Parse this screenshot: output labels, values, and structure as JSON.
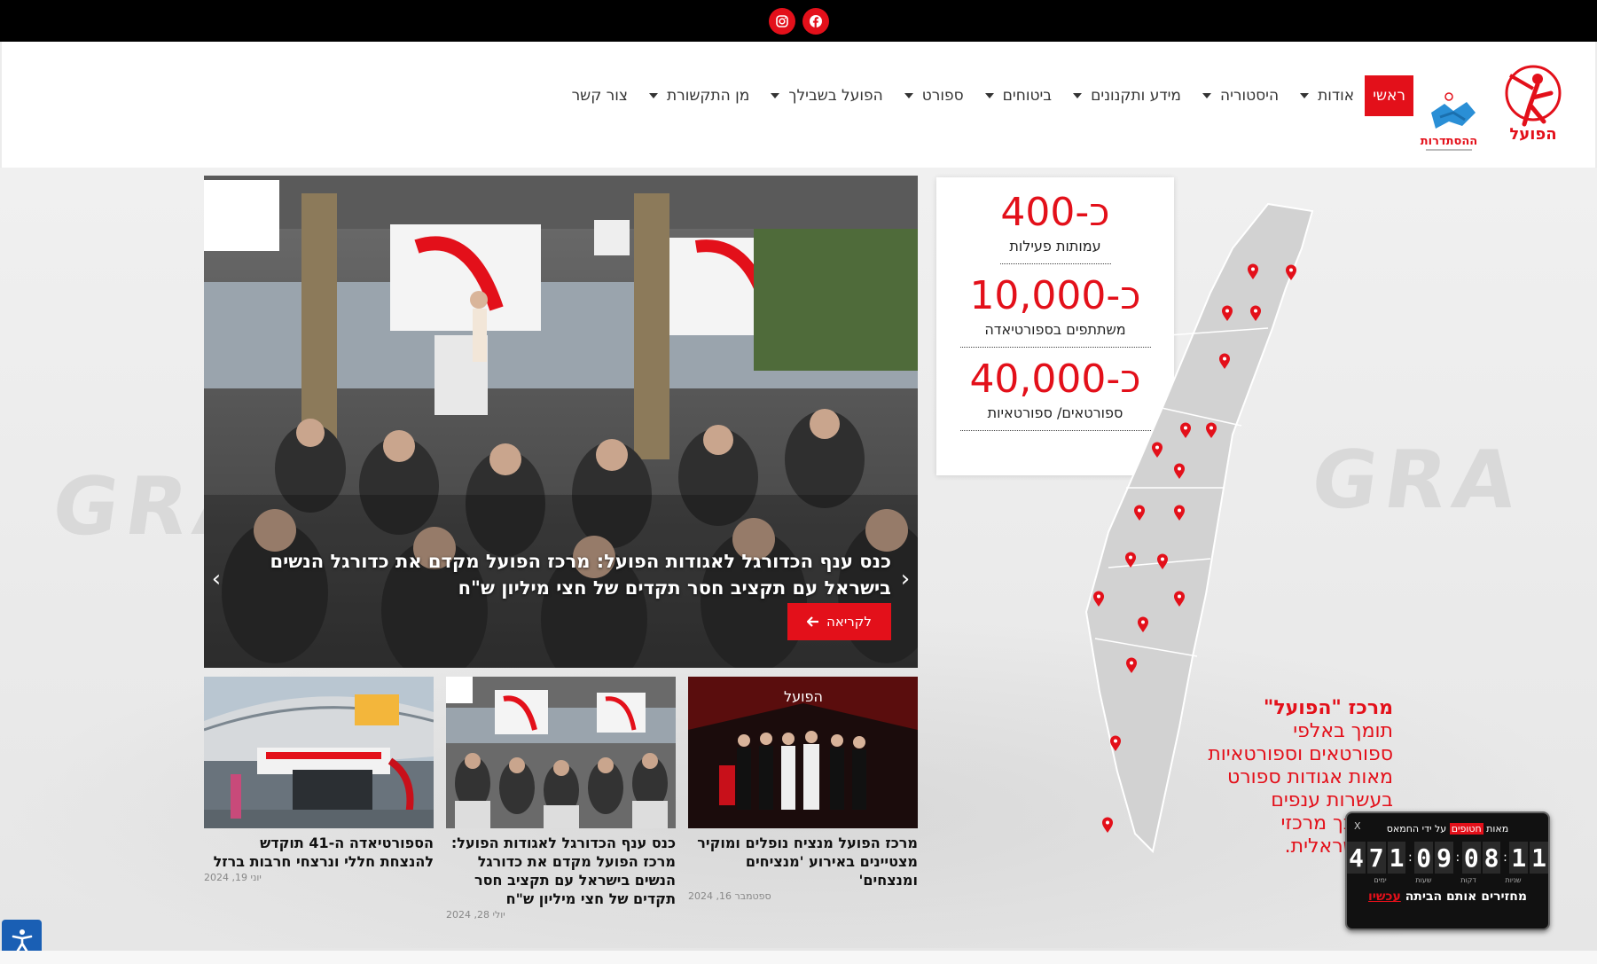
{
  "topbar": {
    "social": [
      {
        "name": "instagram-icon"
      },
      {
        "name": "facebook-icon"
      }
    ]
  },
  "logos": {
    "hapoel_text": "הפועל",
    "histadrut_text": "ההסתדרות"
  },
  "nav": {
    "items": [
      {
        "label": "ראשי",
        "active": true,
        "dropdown": false
      },
      {
        "label": "אודות",
        "dropdown": true
      },
      {
        "label": "היסטוריה",
        "dropdown": true
      },
      {
        "label": "מידע ותקנונים",
        "dropdown": true
      },
      {
        "label": "ביטוחים",
        "dropdown": true
      },
      {
        "label": "ספורט",
        "dropdown": true
      },
      {
        "label": "הפועל בשבילך",
        "dropdown": true
      },
      {
        "label": "מן התקשורת",
        "dropdown": true
      },
      {
        "label": "צור קשר",
        "dropdown": false
      }
    ]
  },
  "slider": {
    "caption": "כנס ענף הכדורגל לאגודות הפועל: מרכז הפועל מקדם את כדורגל הנשים בישראל עם תקציב חסר תקדים של חצי מיליון ש\"ח",
    "read_more": "לקריאה"
  },
  "cards": [
    {
      "title": "מרכז הפועל מנציח נופלים ומוקיר מצטיינים באירוע 'מנציחים ומנצחים'",
      "date": "ספטמבר 16, 2024"
    },
    {
      "title": "כנס ענף הכדורגל לאגודות הפועל: מרכז הפועל מקדם את כדורגל הנשים בישראל עם תקציב חסר תקדים של חצי מיליון ש\"ח",
      "date": "יולי 28, 2024"
    },
    {
      "title": "הספורטיאדה ה-41 תוקדש להנצחת חללי ונרצחי חרבות ברזל",
      "date": "יוני 19, 2024"
    }
  ],
  "stats": [
    {
      "num": "כ-400",
      "label": "עמותות פעילות"
    },
    {
      "num": "כ-10,000",
      "label": "משתתפים בספורטיאדה"
    },
    {
      "num": "כ-40,000",
      "label": "ספורטאים/ ספורטאיות"
    }
  ],
  "map_text": {
    "title": "מרכז \"הפועל\"",
    "lines": [
      "תומך באלפי",
      "ספורטאים וספורטאיות",
      "מאות אגודות ספורט",
      "בעשרות ענפים",
      "ש נדבך מרכזי",
      "ת הישראלית."
    ]
  },
  "countdown": {
    "top_prefix": "מאות",
    "top_highlight": "חטופים",
    "top_suffix": "על ידי החמאס",
    "close": "X",
    "days": [
      "4",
      "7",
      "1"
    ],
    "hours": [
      "0",
      "9"
    ],
    "minutes": [
      "0",
      "8"
    ],
    "seconds": [
      "1",
      "1"
    ],
    "units": [
      "ימים",
      "שעות",
      "דקות",
      "שניות"
    ],
    "bottom_text": "מחזירים אותם הביתה",
    "bottom_highlight": "עכשיו"
  },
  "colors": {
    "brand_red": "#e3101a",
    "topbar": "#000000"
  }
}
